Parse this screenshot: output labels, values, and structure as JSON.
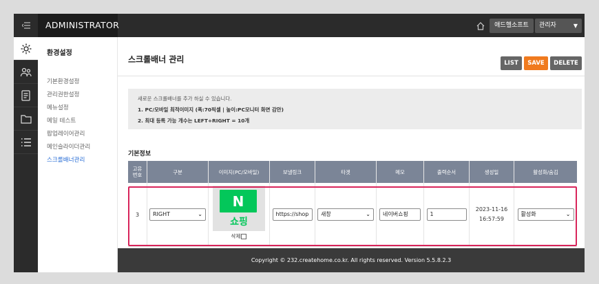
{
  "header": {
    "brand": "ADMINISTRATOR",
    "company_button": "애드헬소프트",
    "user_menu": "관리자"
  },
  "rail": {
    "icons": [
      "gear-icon",
      "users-icon",
      "design-icon",
      "folder-icon",
      "list-icon"
    ],
    "active_index": 0
  },
  "subnav": {
    "title": "환경설정",
    "items": [
      "기본환경설정",
      "관리권한설정",
      "메뉴설정",
      "메일 테스트",
      "팝업레이어관리",
      "메인슬라이더관리",
      "스크롤배너관리"
    ],
    "active_index": 6
  },
  "page": {
    "title": "스크롤배너 관리",
    "buttons": {
      "list": "LIST",
      "save": "SAVE",
      "delete": "DELETE"
    }
  },
  "info": {
    "intro": "새로운 스크롤배너를 추가 하실 수 있습니다.",
    "line1": "1. PC/모바일 최적이미지 (폭:70픽셀 | 높이:PC모니터 화면 감안)",
    "line2": "2. 최대 등록 가능 개수는 LEFT+RIGHT = 10개"
  },
  "section": {
    "title": "기본정보"
  },
  "table": {
    "headers": [
      "고유\n번호",
      "구분",
      "이미지(PC/모바일)",
      "보낼링크",
      "타겟",
      "메모",
      "출력순서",
      "생성일",
      "활성화/숨김"
    ],
    "row": {
      "id": "3",
      "type": "RIGHT",
      "image": {
        "logo_letter": "N",
        "logo_caption": "쇼핑",
        "delete_label": "삭제"
      },
      "link": "https://shop",
      "target": "새창",
      "memo": "네이버쇼핑",
      "order": "1",
      "created_date": "2023-11-16",
      "created_time": "16:57:59",
      "status": "활성화"
    }
  },
  "footer": {
    "text": "Copyright © 232.createhome.co.kr. All rights reserved. Version 5.5.8.2.3"
  },
  "colors": {
    "save": "#f07a1e",
    "highlight": "#d8245a",
    "table_header": "#7b8597",
    "naver_green": "#03c75a"
  }
}
